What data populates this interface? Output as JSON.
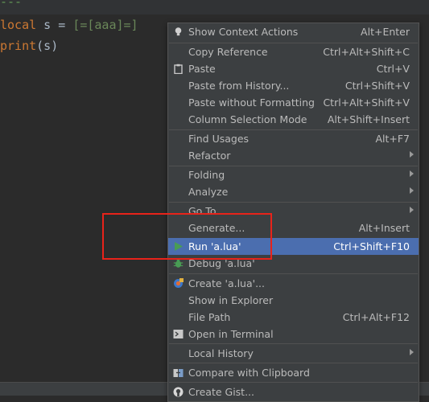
{
  "editor": {
    "top_dashes": "---",
    "line1": {
      "kw": "local",
      "rest": " s = ",
      "str": "[=[aaa]=]"
    },
    "line2": {
      "fn": "print",
      "rest": "(s)"
    }
  },
  "menu": {
    "items": [
      {
        "label": "Show Context Actions",
        "shortcut": "Alt+Enter",
        "icon": "lightbulb-icon"
      },
      {
        "label": "Copy Reference",
        "shortcut": "Ctrl+Alt+Shift+C"
      },
      {
        "label": "Paste",
        "shortcut": "Ctrl+V",
        "icon": "clipboard-icon"
      },
      {
        "label": "Paste from History...",
        "shortcut": "Ctrl+Shift+V"
      },
      {
        "label": "Paste without Formatting",
        "shortcut": "Ctrl+Alt+Shift+V"
      },
      {
        "label": "Column Selection Mode",
        "shortcut": "Alt+Shift+Insert"
      },
      {
        "label": "Find Usages",
        "shortcut": "Alt+F7"
      },
      {
        "label": "Refactor",
        "submenu": true
      },
      {
        "label": "Folding",
        "submenu": true
      },
      {
        "label": "Analyze",
        "submenu": true
      },
      {
        "label": "Go To",
        "submenu": true
      },
      {
        "label": "Generate...",
        "shortcut": "Alt+Insert"
      },
      {
        "label": "Run 'a.lua'",
        "shortcut": "Ctrl+Shift+F10",
        "icon": "run-icon",
        "selected": true
      },
      {
        "label": "Debug 'a.lua'",
        "icon": "debug-icon"
      },
      {
        "label": "Create 'a.lua'...",
        "icon": "create-config-icon"
      },
      {
        "label": "Show in Explorer"
      },
      {
        "label": "File Path",
        "shortcut": "Ctrl+Alt+F12"
      },
      {
        "label": "Open in Terminal",
        "icon": "terminal-icon"
      },
      {
        "label": "Local History",
        "submenu": true
      },
      {
        "label": "Compare with Clipboard",
        "icon": "compare-icon"
      },
      {
        "label": "Create Gist...",
        "icon": "github-icon"
      }
    ]
  },
  "colors": {
    "selection": "#4b6eaf",
    "highlight_box": "#e8231a",
    "run_green": "#499c54"
  }
}
